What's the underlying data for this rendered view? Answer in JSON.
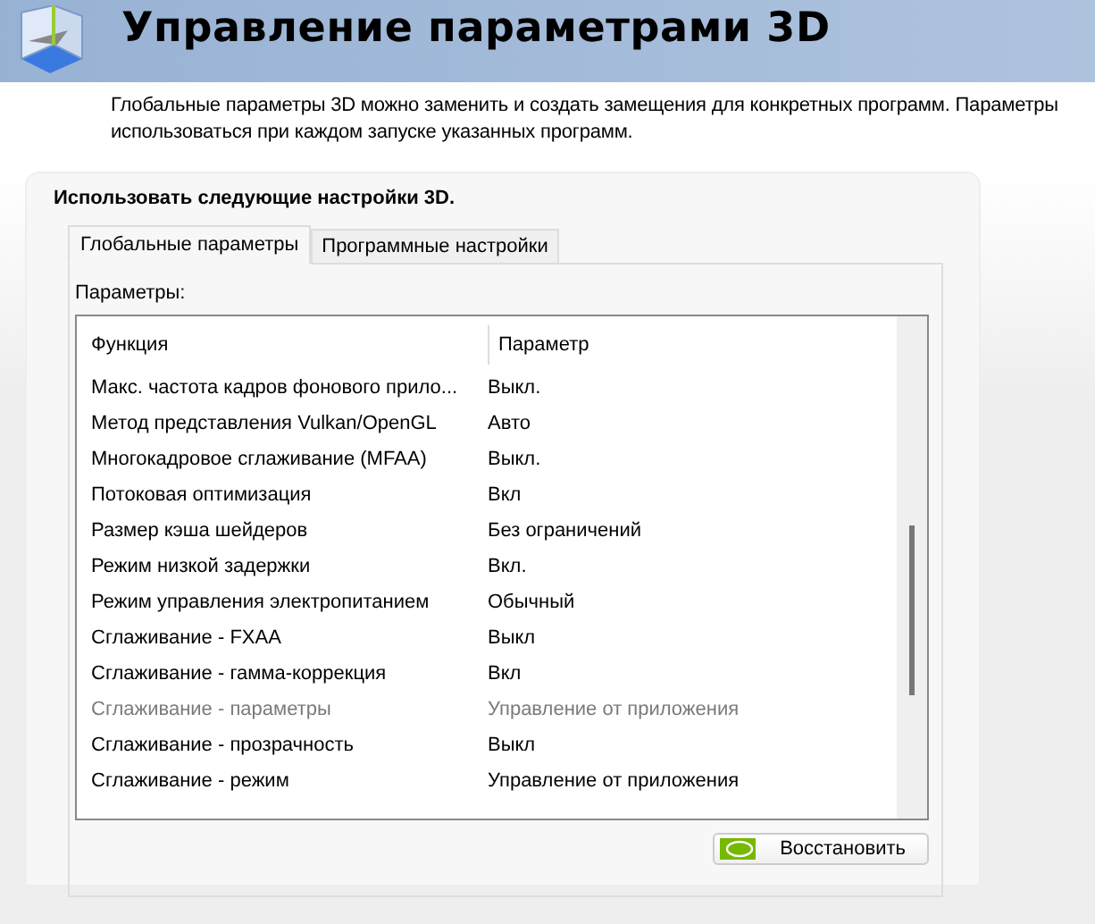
{
  "header": {
    "title": "Управление параметрами 3D"
  },
  "description": [
    "Глобальные параметры 3D можно заменить и создать замещения для конкретных программ. Параметры",
    "использоваться при каждом запуске указанных программ."
  ],
  "panel": {
    "heading": "Использовать следующие настройки 3D.",
    "tabs": [
      {
        "label": "Глобальные параметры",
        "selected": true
      },
      {
        "label": "Программные настройки",
        "selected": false
      }
    ],
    "list_label": "Параметры:",
    "table": {
      "columns": [
        "Функция",
        "Параметр"
      ],
      "rows": [
        {
          "feature": "Макс. частота кадров фонового прило...",
          "setting": "Выкл.",
          "disabled": false
        },
        {
          "feature": "Метод представления Vulkan/OpenGL",
          "setting": "Авто",
          "disabled": false
        },
        {
          "feature": "Многокадровое сглаживание (MFAA)",
          "setting": "Выкл.",
          "disabled": false
        },
        {
          "feature": "Потоковая оптимизация",
          "setting": "Вкл",
          "disabled": false
        },
        {
          "feature": "Размер кэша шейдеров",
          "setting": "Без ограничений",
          "disabled": false
        },
        {
          "feature": "Режим низкой задержки",
          "setting": "Вкл.",
          "disabled": false
        },
        {
          "feature": "Режим управления электропитанием",
          "setting": "Обычный",
          "disabled": false
        },
        {
          "feature": "Сглаживание - FXAA",
          "setting": "Выкл",
          "disabled": false
        },
        {
          "feature": "Сглаживание - гамма-коррекция",
          "setting": "Вкл",
          "disabled": false
        },
        {
          "feature": "Сглаживание - параметры",
          "setting": "Управление от приложения",
          "disabled": true
        },
        {
          "feature": "Сглаживание - прозрачность",
          "setting": "Выкл",
          "disabled": false
        },
        {
          "feature": "Сглаживание - режим",
          "setting": "Управление от приложения",
          "disabled": false
        }
      ]
    },
    "restore_button": "Восстановить"
  }
}
